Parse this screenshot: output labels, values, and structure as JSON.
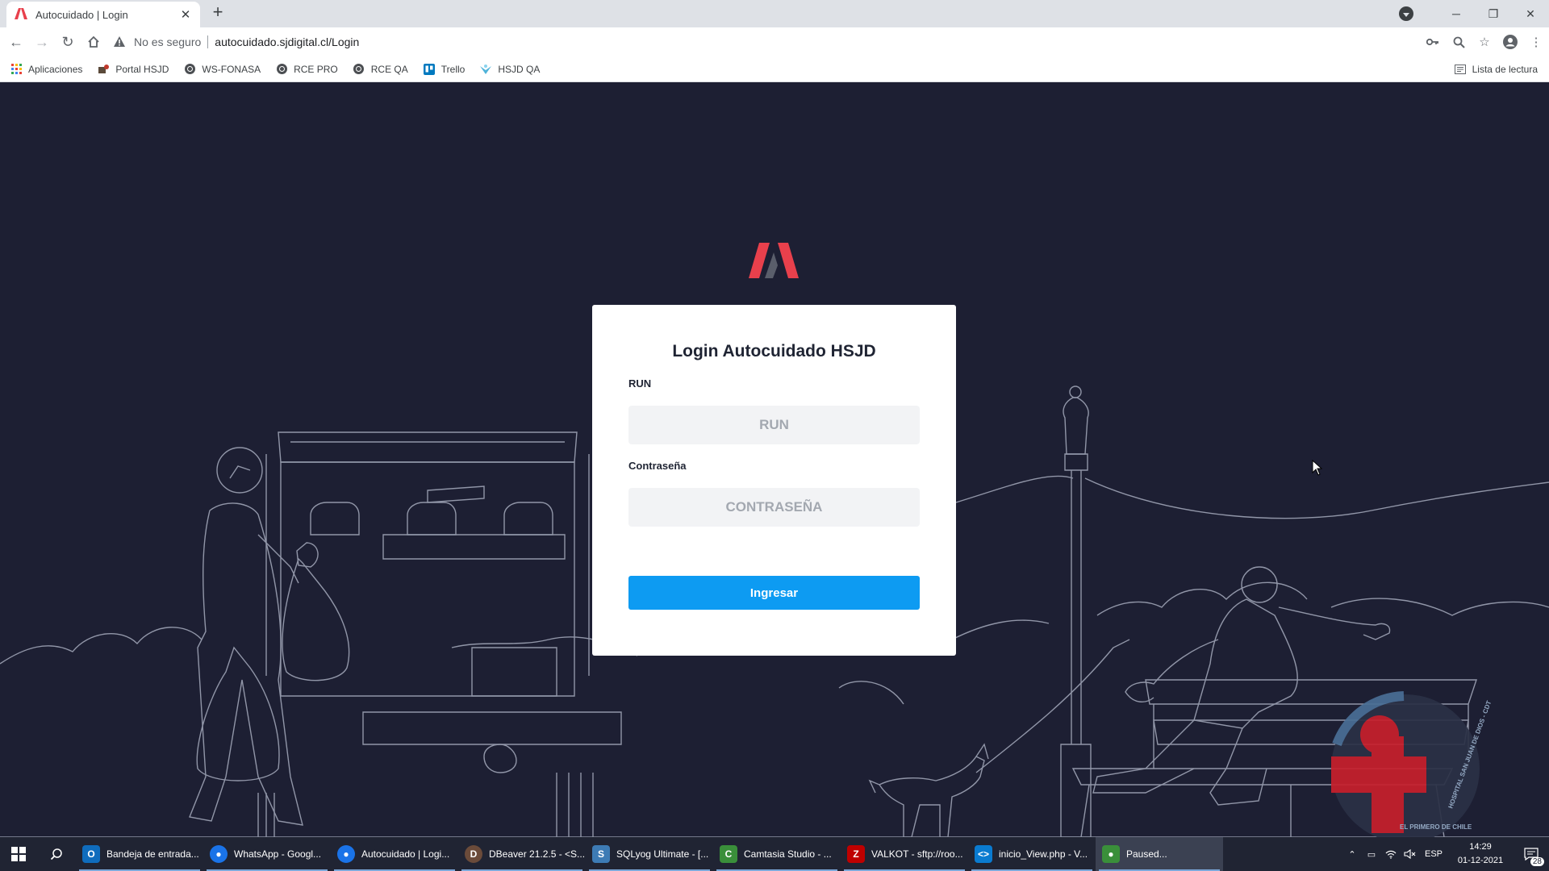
{
  "browser": {
    "tab_title": "Autocuidado | Login",
    "not_secure": "No es seguro",
    "url": "autocuidado.sjdigital.cl/Login",
    "bookmarks": [
      {
        "label": "Aplicaciones",
        "icon": "apps-grid-icon"
      },
      {
        "label": "Portal HSJD",
        "icon": "portal-icon"
      },
      {
        "label": "WS-FONASA",
        "icon": "globe-icon"
      },
      {
        "label": "RCE PRO",
        "icon": "globe-icon"
      },
      {
        "label": "RCE QA",
        "icon": "globe-icon"
      },
      {
        "label": "Trello",
        "icon": "trello-icon"
      },
      {
        "label": "HSJD QA",
        "icon": "hsjd-qa-icon"
      }
    ],
    "reading_list": "Lista de lectura"
  },
  "login": {
    "title": "Login Autocuidado HSJD",
    "run_label": "RUN",
    "run_placeholder": "RUN",
    "password_label": "Contraseña",
    "password_placeholder": "CONTRASEÑA",
    "submit_label": "Ingresar"
  },
  "watermark": {
    "arc_text": "HOSPITAL SAN JUAN DE DIOS - CDT",
    "motto": "EL PRIMERO DE CHILE"
  },
  "taskbar": {
    "tasks": [
      {
        "label": "Bandeja de entrada...",
        "icon": "outlook-icon",
        "color": "#0f6cbd"
      },
      {
        "label": "WhatsApp - Googl...",
        "icon": "chrome-icon",
        "color": "#1a73e8"
      },
      {
        "label": "Autocuidado | Logi...",
        "icon": "chrome-icon",
        "color": "#1a73e8"
      },
      {
        "label": "DBeaver 21.2.5 - <S...",
        "icon": "dbeaver-icon",
        "color": "#6b4b3a"
      },
      {
        "label": "SQLyog Ultimate - [...",
        "icon": "sqlyog-icon",
        "color": "#3d7bb5"
      },
      {
        "label": "Camtasia Studio - ...",
        "icon": "camtasia-icon",
        "color": "#3a8f3a"
      },
      {
        "label": "VALKOT - sftp://roo...",
        "icon": "filezilla-icon",
        "color": "#bf0000"
      },
      {
        "label": "inicio_View.php - V...",
        "icon": "vscode-icon",
        "color": "#0a7bd0"
      },
      {
        "label": "Paused...",
        "icon": "camtasia-recorder-icon",
        "color": "#3a8f3a"
      }
    ],
    "language": "ESP",
    "time": "14:29",
    "date": "01-12-2021",
    "notifications": "28"
  }
}
